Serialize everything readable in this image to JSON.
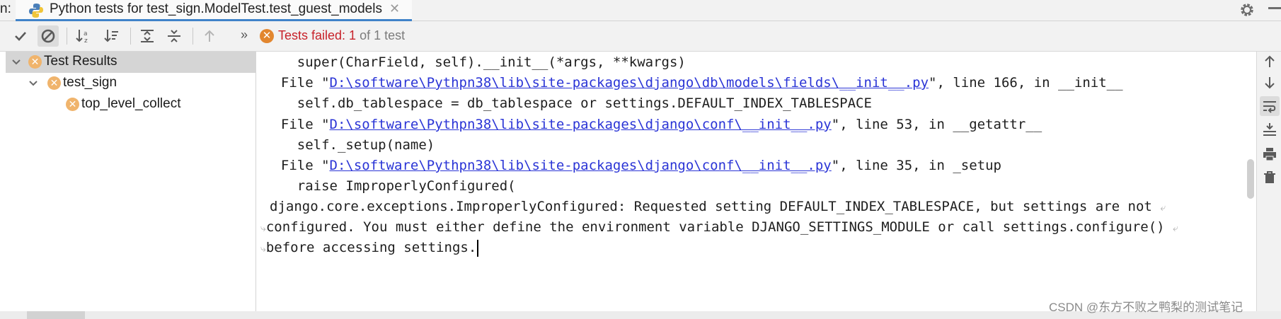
{
  "tab_bar": {
    "run_label": "n:",
    "tab_title": "Python tests for test_sign.ModelTest.test_guest_models",
    "close_icon": "close-icon",
    "settings_icon": "gear-icon"
  },
  "toolbar": {
    "icons": [
      "check-icon",
      "stop-icon",
      "sort-alpha-icon",
      "sort-duration-icon",
      "expand-all-icon",
      "collapse-all-icon",
      "previous-failure-icon"
    ],
    "more": "»",
    "status_failed_label": "Tests failed: ",
    "status_failed_count": "1",
    "status_total": " of 1 test"
  },
  "tree": {
    "items": [
      {
        "label": "Test Results",
        "level": 0,
        "expanded": true,
        "selected": true
      },
      {
        "label": "test_sign",
        "level": 1,
        "expanded": true,
        "selected": false
      },
      {
        "label": "top_level_collect",
        "level": 2,
        "expanded": false,
        "selected": false
      }
    ]
  },
  "console": {
    "lines": [
      {
        "indent": "    ",
        "pre": "super(CharField, self).__init__(*args, **kwargs)"
      },
      {
        "indent": "  ",
        "pre": "File \"",
        "link": "D:\\software\\Pythpn38\\lib\\site-packages\\django\\db\\models\\fields\\__init__.py",
        "post": "\", line 166, in __init__"
      },
      {
        "indent": "    ",
        "pre": "self.db_tablespace = db_tablespace or settings.DEFAULT_INDEX_TABLESPACE"
      },
      {
        "indent": "  ",
        "pre": "File \"",
        "link": "D:\\software\\Pythpn38\\lib\\site-packages\\django\\conf\\__init__.py",
        "post": "\", line 53, in __getattr__"
      },
      {
        "indent": "    ",
        "pre": "self._setup(name)"
      },
      {
        "indent": "  ",
        "pre": "File \"",
        "link": "D:\\software\\Pythpn38\\lib\\site-packages\\django\\conf\\__init__.py",
        "post": "\", line 35, in _setup"
      },
      {
        "indent": "    ",
        "pre": "raise ImproperlyConfigured("
      },
      {
        "indent": "",
        "pre": "django.core.exceptions.ImproperlyConfigured: Requested setting DEFAULT_INDEX_TABLESPACE, but settings are not"
      },
      {
        "indent": "",
        "pre": "configured. You must either define the environment variable DJANGO_SETTINGS_MODULE or call settings.configure()"
      },
      {
        "indent": "",
        "pre": "before accessing settings."
      }
    ]
  },
  "right_toolbar": {
    "icons": [
      "arrow-up-icon",
      "arrow-down-icon",
      "soft-wrap-icon",
      "scroll-to-end-icon",
      "print-icon",
      "trash-icon"
    ]
  },
  "watermark": "CSDN @东方不败之鸭梨的测试笔记",
  "colors": {
    "link": "#2a34d6",
    "failed_text": "#c7222a",
    "fail_icon": "#e2862f",
    "tab_underline": "#4083c9"
  }
}
